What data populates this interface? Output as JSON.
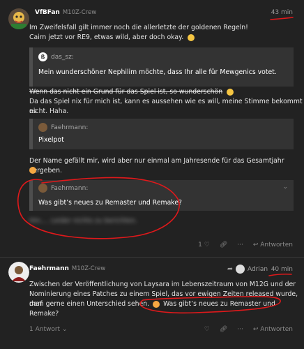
{
  "post1": {
    "username": "VfBFan",
    "user_title": "M10Z-Crew",
    "time": "43 min",
    "line1": "Im Zweifelsfall gilt immer noch die allerletzte der goldenen Regeln!",
    "line2": "Cairn jetzt vor RE9, etwas wild, aber doch okay.",
    "quote1": {
      "author": "das_sz:",
      "body": "Mein wunderschöner Nephilim möchte, dass Ihr alle für Mewgenics votet."
    },
    "strike_text": "Wenn das nicht ein Grund für das Spiel ist, so wunderschön",
    "line3": "Da das Spiel nix für mich ist, kann es aussehen wie es will, meine Stimme bekommt es",
    "line4": "nicht. Haha.",
    "quote2": {
      "author": "Faehrmann:",
      "body": "Pixelpot"
    },
    "line5": "Der Name gefällt mir, wird aber nur einmal am Jahresende für das Gesamtjahr vergeben.",
    "quote3": {
      "author": "Faehrmann:",
      "body": "Was gibt’s neues zu Remaster und Remake?"
    },
    "blurred": "Hm…. Leider nichts zu berichten.",
    "like_count": "1",
    "reply_label": "Antworten"
  },
  "post2": {
    "username": "Faehrmann",
    "user_title": "M10Z-Crew",
    "reply_to": "Adrian",
    "time": "40 min",
    "line1": "Zwischen der Veröffentlichung von Laysara im Lebenszeitraum von M12G und der",
    "line2": "Nominierung eines Patches zu einem Spiel, das vor ewigen Zeiten released wurde, darf",
    "line3a": "man gerne einen Unterschied sehen.",
    "line3b": "Was gibt’s neues zu Remaster und Remake?",
    "replies_label": "1 Antwort",
    "reply_label": "Antworten"
  },
  "colors": {
    "background": "#222222",
    "quote_bg": "#333333",
    "annotation_red": "#e0191b"
  }
}
